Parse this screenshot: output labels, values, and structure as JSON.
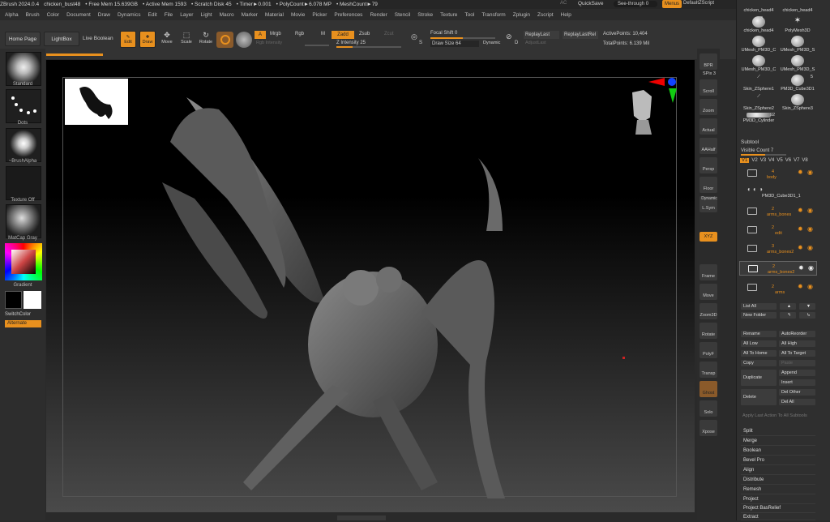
{
  "titlebar": {
    "app": "ZBrush 2024.0.4",
    "file": "chicken_bust48",
    "free_mem": "• Free Mem 15.639GB",
    "active_mem": "• Active Mem 1593",
    "scratch": "• Scratch Disk 45",
    "timer": "• Timer►0.001",
    "polycount": "• PolyCount►6.078 MP",
    "meshcount": "• MeshCount►79",
    "ac": "AC",
    "quicksave": "QuickSave",
    "seethrough": "See-through   0",
    "menus": "Menus",
    "script": "DefaultZScript"
  },
  "menubar": [
    "Alpha",
    "Brush",
    "Color",
    "Document",
    "Draw",
    "Dynamics",
    "Edit",
    "File",
    "Layer",
    "Light",
    "Macro",
    "Marker",
    "Material",
    "Movie",
    "Picker",
    "Preferences",
    "Render",
    "Stencil",
    "Stroke",
    "Texture",
    "Tool",
    "Transform",
    "Zplugin",
    "Zscript",
    "Help"
  ],
  "toolbar": {
    "home": "Home Page",
    "lightbox": "LightBox",
    "liveboolean": "Live Boolean",
    "edit": "Edit",
    "draw": "Draw",
    "move": "Move",
    "scale": "Scale",
    "rotate": "Rotate",
    "a": "A",
    "mrgb": "Mrgb",
    "rgb": "Rgb",
    "m": "M",
    "rgb_intensity": "Rgb Intensity",
    "zadd": "Zadd",
    "zsub": "Zsub",
    "zcut": "Zcut",
    "z_intensity": "Z Intensity 25",
    "focal_shift": "Focal Shift 0",
    "draw_size": "Draw Size 64",
    "dynamic": "Dynamic",
    "s": "S",
    "d": "D",
    "replaylast": "ReplayLast",
    "replaylastrel": "ReplayLastRel",
    "adjustlast": "AdjustLast",
    "activepoints": "ActivePoints: 10,404",
    "totalpoints": "TotalPoints: 6.139 Mil"
  },
  "leftpanel": {
    "standard": "Standard",
    "dots": "Dots",
    "brushalpha": "~BrushAlpha",
    "texture": "Texture Off",
    "matcap": "MatCap Gray",
    "gradient": "Gradient",
    "switchcolor": "SwitchColor",
    "alternate": "Alternate"
  },
  "rightshelf": [
    "BPR",
    "SPix 3",
    "Scroll",
    "Zoom",
    "Actual",
    "AAHalf",
    "Persp",
    "Floor",
    "L.Sym",
    "Dynamic",
    "XYZ",
    "Frame",
    "Move",
    "Zoom3D",
    "Rotate",
    "PolyF",
    "Transp",
    "Ghost",
    "Solo",
    "Xpose"
  ],
  "tools": [
    "chicken_head4",
    "chicken_head4",
    "chicken_head4",
    "PolyMesh3D",
    "UMesh_PM3D_C",
    "UMesh_PM3D_S",
    "UMesh_PM3D_C",
    "UMesh_PM3D_S",
    "Skin_ZSphere1",
    "PM3D_Cube3D1",
    "Skin_ZSphere2",
    "Skin_ZSphere3",
    "PM3D_Cylinder"
  ],
  "tool_counts": {
    "c1": "3",
    "c2": "5",
    "c3": "92"
  },
  "subtool": {
    "title": "Subtool",
    "visible_count": "Visible Count  7",
    "versions": [
      "V1",
      "V2",
      "V3",
      "V4",
      "V5",
      "V6",
      "V7",
      "V8"
    ],
    "rows": [
      {
        "n": "4",
        "name": "body"
      },
      {
        "n": "",
        "name": "PM3D_Cube3D1_1"
      },
      {
        "n": "2",
        "name": "arms_bones"
      },
      {
        "n": "2",
        "name": "edit"
      },
      {
        "n": "3",
        "name": "arms_bones2"
      },
      {
        "n": "2",
        "name": "arms_bones2"
      },
      {
        "n": "2",
        "name": "arms"
      }
    ]
  },
  "buttons": {
    "listall": "List All",
    "newfolder": "New Folder",
    "rename": "Rename",
    "autoreorder": "AutoReorder",
    "alllow": "All Low",
    "allhigh": "All High",
    "alltohome": "All To Home",
    "alltotarget": "All To Target",
    "copy": "Copy",
    "paste": "Paste",
    "duplicate": "Duplicate",
    "append": "Append",
    "insert": "Insert",
    "delete": "Delete",
    "delother": "Del Other",
    "delall": "Del All",
    "applylast": "Apply Last Action To All Subtools"
  },
  "actions": [
    "Split",
    "Merge",
    "Boolean",
    "Bevel Pro",
    "Align",
    "Distribute",
    "Remesh",
    "Project",
    "Project BasRelief",
    "Extract"
  ],
  "colors": {
    "accent": "#e8901e",
    "panel": "#2f2f2f"
  }
}
